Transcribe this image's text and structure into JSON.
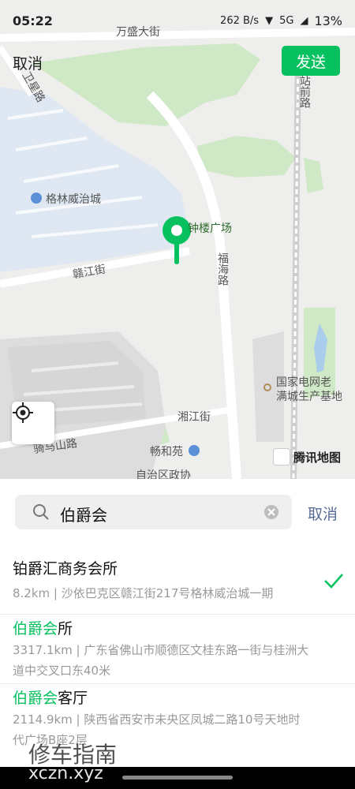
{
  "status_bar": {
    "time": "05:22",
    "net_speed": "262 B/s",
    "network": "5G",
    "battery": "13%"
  },
  "header": {
    "cancel_label": "取消",
    "send_label": "发送"
  },
  "map": {
    "labels": {
      "road_top": "万盛大街",
      "road_left": "卫星路",
      "road_station": "站前路",
      "poi_gelin": "格林威治城",
      "poi_zhonglou": "钟楼广场",
      "road_ganjiang": "赣江街",
      "road_fuhai": "福海路",
      "poi_grid": "国家电网老",
      "poi_grid2": "满城生产基地",
      "road_xiangjiang": "湘江街",
      "road_qima": "骑马山路",
      "poi_changhe": "畅和苑",
      "poi_zizhi": "自治区政协"
    },
    "logo": "腾讯地图",
    "colors": {
      "pin": "#07c160",
      "residential": "#dfe8f2",
      "park": "#cfe8c6"
    }
  },
  "search": {
    "value": "伯爵会",
    "cancel_label": "取消"
  },
  "results": [
    {
      "prefix": "铂爵汇商务会所",
      "highlight": "",
      "suffix": "",
      "address": "8.2km | 沙依巴克区赣江街217号格林威治城一期",
      "selected": true
    },
    {
      "prefix": "",
      "highlight": "伯爵会",
      "suffix": "所",
      "address": "3317.1km | 广东省佛山市顺德区文桂东路一街与桂洲大道中交叉口东40米",
      "selected": false
    },
    {
      "prefix": "",
      "highlight": "伯爵会",
      "suffix": "客厅",
      "address": "2114.9km | 陕西省西安市未央区凤城二路10号天地时代广场B座2层",
      "selected": false
    }
  ],
  "watermark": {
    "text": "修车指南",
    "url": "xczn.xyz"
  }
}
